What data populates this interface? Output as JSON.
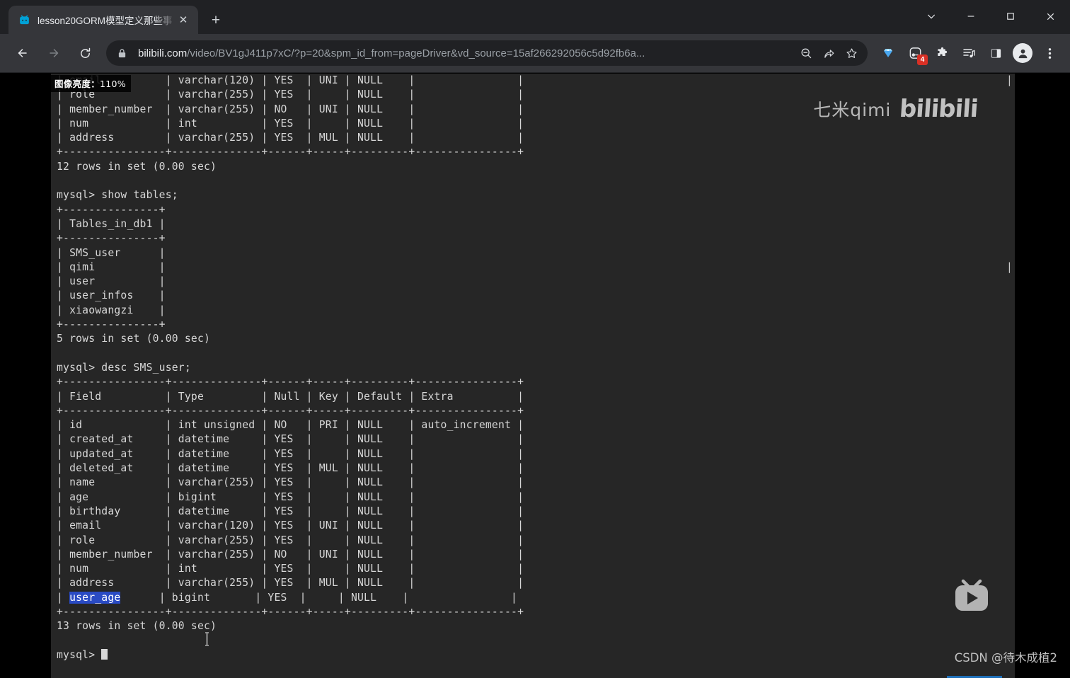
{
  "window": {
    "controls": {
      "tab_search": "tab-search",
      "minimize": "minimize",
      "maximize": "maximize",
      "close": "close"
    }
  },
  "tabstrip": {
    "tabs": [
      {
        "title": "lesson20GORM模型定义那些事",
        "favicon": "bilibili-icon",
        "close_label": "✕"
      }
    ],
    "new_tab_label": "+"
  },
  "toolbar": {
    "back_label": "←",
    "forward_label": "→",
    "reload_label": "⟳",
    "url_host": "bilibili.com",
    "url_path": "/video/BV1gJ411p7xC/?p=20&spm_id_from=pageDriver&vd_source=15af266292056c5d92fb6a...",
    "zoom_out_icon": "zoom-out-icon",
    "share_icon": "share-icon",
    "bookmark_icon": "bookmark-star-icon",
    "extensions": [
      {
        "name": "diamond-extension-icon",
        "badge": ""
      },
      {
        "name": "screen-capture-extension-icon",
        "badge": "4"
      },
      {
        "name": "puzzle-extensions-icon",
        "badge": ""
      },
      {
        "name": "reading-list-icon",
        "badge": ""
      },
      {
        "name": "side-panel-icon",
        "badge": ""
      }
    ],
    "profile_icon": "profile-avatar-icon",
    "menu_icon": "three-dot-menu-icon"
  },
  "overlay": {
    "brightness_label": "图像亮度：",
    "brightness_value": "110%",
    "watermark_author": "七米qimi",
    "watermark_brand": "bilibili",
    "csdn_watermark": "CSDN @待木成植2",
    "player_logo": "bilibili-tv-play-icon"
  },
  "terminal": {
    "lines_top": [
      "| email          | varchar(120) | YES  | UNI | NULL    |                |",
      "| role           | varchar(255) | YES  |     | NULL    |                |",
      "| member_number  | varchar(255) | NO   | UNI | NULL    |                |",
      "| num            | int          | YES  |     | NULL    |                |",
      "| address        | varchar(255) | YES  | MUL | NULL    |                |",
      "+----------------+--------------+------+-----+---------+----------------+",
      "12 rows in set (0.00 sec)",
      "",
      "mysql> show tables;",
      "+---------------+",
      "| Tables_in_db1 |",
      "+---------------+",
      "| SMS_user      |",
      "| qimi          |",
      "| user          |",
      "| user_infos    |",
      "| xiaowangzi    |",
      "+---------------+",
      "5 rows in set (0.00 sec)",
      "",
      "mysql> desc SMS_user;",
      "+----------------+--------------+------+-----+---------+----------------+",
      "| Field          | Type         | Null | Key | Default | Extra          |",
      "+----------------+--------------+------+-----+---------+----------------+",
      "| id             | int unsigned | NO   | PRI | NULL    | auto_increment |",
      "| created_at     | datetime     | YES  |     | NULL    |                |",
      "| updated_at     | datetime     | YES  |     | NULL    |                |",
      "| deleted_at     | datetime     | YES  | MUL | NULL    |                |",
      "| name           | varchar(255) | YES  |     | NULL    |                |",
      "| age            | bigint       | YES  |     | NULL    |                |",
      "| birthday       | datetime     | YES  |     | NULL    |                |",
      "| email          | varchar(120) | YES  | UNI | NULL    |                |",
      "| role           | varchar(255) | YES  |     | NULL    |                |",
      "| member_number  | varchar(255) | NO   | UNI | NULL    |                |",
      "| num            | int          | YES  |     | NULL    |                |",
      "| address        | varchar(255) | YES  | MUL | NULL    |                |"
    ],
    "highlighted_row": {
      "prefix": "| ",
      "selected": "user_age",
      "suffix": "      | bigint       | YES  |     | NULL    |                |"
    },
    "lines_bottom": [
      "+----------------+--------------+------+-----+---------+----------------+",
      "13 rows in set (0.00 sec)",
      "",
      "mysql> "
    ],
    "right_gutter": "|\n \n \n \n \n \n \n \n \n \n \n \n \n|\n"
  }
}
